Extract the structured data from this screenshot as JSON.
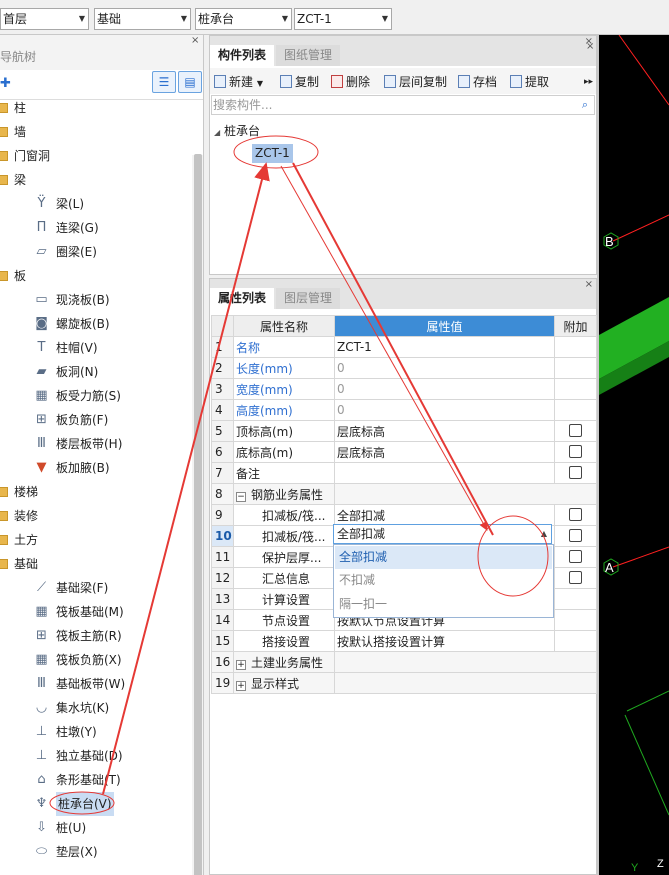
{
  "topbar": {
    "floor": "首层",
    "category": "基础",
    "component_type": "桩承台",
    "component_name": "ZCT-1"
  },
  "nav": {
    "title": "导航树",
    "close": "×",
    "add_icon": "add-icon",
    "items": [
      {
        "label": "柱",
        "type": "folder"
      },
      {
        "label": "墙",
        "type": "folder"
      },
      {
        "label": "门窗洞",
        "type": "folder"
      },
      {
        "label": "梁",
        "type": "folder"
      },
      {
        "label": "梁(L)",
        "type": "item"
      },
      {
        "label": "连梁(G)",
        "type": "item"
      },
      {
        "label": "圈梁(E)",
        "type": "item"
      },
      {
        "label": "板",
        "type": "folder"
      },
      {
        "label": "现浇板(B)",
        "type": "item"
      },
      {
        "label": "螺旋板(B)",
        "type": "item"
      },
      {
        "label": "柱帽(V)",
        "type": "item"
      },
      {
        "label": "板洞(N)",
        "type": "item"
      },
      {
        "label": "板受力筋(S)",
        "type": "item"
      },
      {
        "label": "板负筋(F)",
        "type": "item"
      },
      {
        "label": "楼层板带(H)",
        "type": "item"
      },
      {
        "label": "板加腋(B)",
        "type": "item"
      },
      {
        "label": "楼梯",
        "type": "folder"
      },
      {
        "label": "装修",
        "type": "folder"
      },
      {
        "label": "土方",
        "type": "folder"
      },
      {
        "label": "基础",
        "type": "folder"
      },
      {
        "label": "基础梁(F)",
        "type": "item"
      },
      {
        "label": "筏板基础(M)",
        "type": "item"
      },
      {
        "label": "筏板主筋(R)",
        "type": "item"
      },
      {
        "label": "筏板负筋(X)",
        "type": "item"
      },
      {
        "label": "基础板带(W)",
        "type": "item"
      },
      {
        "label": "集水坑(K)",
        "type": "item"
      },
      {
        "label": "柱墩(Y)",
        "type": "item"
      },
      {
        "label": "独立基础(D)",
        "type": "item"
      },
      {
        "label": "条形基础(T)",
        "type": "item"
      },
      {
        "label": "桩承台(V)",
        "type": "item",
        "selected": true
      },
      {
        "label": "桩(U)",
        "type": "item"
      },
      {
        "label": "垫层(X)",
        "type": "item"
      }
    ]
  },
  "component_list": {
    "tabs": [
      "构件列表",
      "图纸管理"
    ],
    "toolbar": {
      "new": "新建",
      "copy": "复制",
      "delete": "删除",
      "floor_copy": "层间复制",
      "save": "存档",
      "extract": "提取",
      "more": "▸▸"
    },
    "search_placeholder": "搜索构件...",
    "tree_root": "桩承台",
    "tree_child": "ZCT-1"
  },
  "properties": {
    "tabs": [
      "属性列表",
      "图层管理"
    ],
    "headers": {
      "name": "属性名称",
      "value": "属性值",
      "extra": "附加"
    },
    "rows": [
      {
        "idx": "1",
        "name": "名称",
        "value": "ZCT-1",
        "name_blue": true
      },
      {
        "idx": "2",
        "name": "长度(mm)",
        "value": "0",
        "name_blue": true,
        "gray": true
      },
      {
        "idx": "3",
        "name": "宽度(mm)",
        "value": "0",
        "name_blue": true,
        "gray": true
      },
      {
        "idx": "4",
        "name": "高度(mm)",
        "value": "0",
        "name_blue": true,
        "gray": true
      },
      {
        "idx": "5",
        "name": "顶标高(m)",
        "value": "层底标高",
        "check": true
      },
      {
        "idx": "6",
        "name": "底标高(m)",
        "value": "层底标高",
        "check": true
      },
      {
        "idx": "7",
        "name": "备注",
        "value": "",
        "check": true
      },
      {
        "idx": "8",
        "name": "钢筋业务属性",
        "value": "",
        "group": true,
        "expander": "−"
      },
      {
        "idx": "9",
        "name": "扣减板/筏...",
        "value": "全部扣减",
        "indent": true,
        "check": true
      },
      {
        "idx": "10",
        "name": "扣减板/筏...",
        "value": "",
        "indent": true,
        "check": true,
        "editing": true
      },
      {
        "idx": "11",
        "name": "保护层厚...",
        "value": "",
        "indent": true,
        "check": true
      },
      {
        "idx": "12",
        "name": "汇总信息",
        "value": "",
        "indent": true,
        "check": true
      },
      {
        "idx": "13",
        "name": "计算设置",
        "value": "",
        "indent": true
      },
      {
        "idx": "14",
        "name": "节点设置",
        "value": "按默认节点设置计算",
        "indent": true
      },
      {
        "idx": "15",
        "name": "搭接设置",
        "value": "按默认搭接设置计算",
        "indent": true
      },
      {
        "idx": "16",
        "name": "土建业务属性",
        "value": "",
        "group": true,
        "expander": "+"
      },
      {
        "idx": "19",
        "name": "显示样式",
        "value": "",
        "group": true,
        "expander": "+"
      }
    ],
    "edit_value": "全部扣减",
    "dropdown_options": [
      "全部扣减",
      "不扣减",
      "隔一扣一"
    ],
    "dropdown_selected": 0
  },
  "view3d": {
    "axis_a": "A",
    "axis_b": "B",
    "axis_y": "Y",
    "axis_z": "Z",
    "colors": {
      "slab": "#22b022",
      "slab_dark": "#168016",
      "axis": "#ff2020",
      "grid": "#1fa81f"
    }
  },
  "annotations": {
    "color": "#e53935"
  }
}
